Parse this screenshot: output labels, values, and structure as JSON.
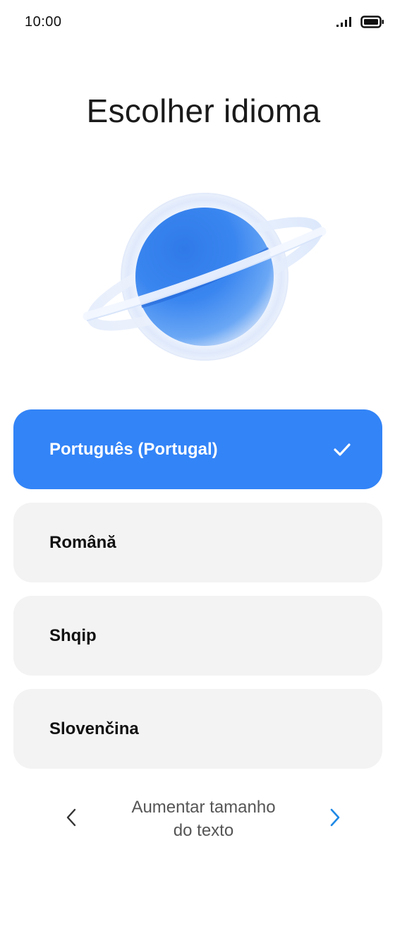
{
  "status_bar": {
    "time": "10:00",
    "signal_icon": "signal-icon",
    "battery_icon": "battery-icon"
  },
  "title": "Escolher idioma",
  "illustration_icon": "planet-illustration",
  "languages": [
    {
      "label": "Português (Portugal)",
      "selected": true
    },
    {
      "label": "Română",
      "selected": false
    },
    {
      "label": "Shqip",
      "selected": false
    },
    {
      "label": "Slovenčina",
      "selected": false
    }
  ],
  "text_size": {
    "label": "Aumentar tamanho\ndo texto",
    "prev_icon": "chevron-left-icon",
    "next_icon": "chevron-right-icon"
  },
  "colors": {
    "accent": "#3384f7",
    "item_background": "#f3f3f3",
    "next_arrow": "#1e88e5"
  }
}
